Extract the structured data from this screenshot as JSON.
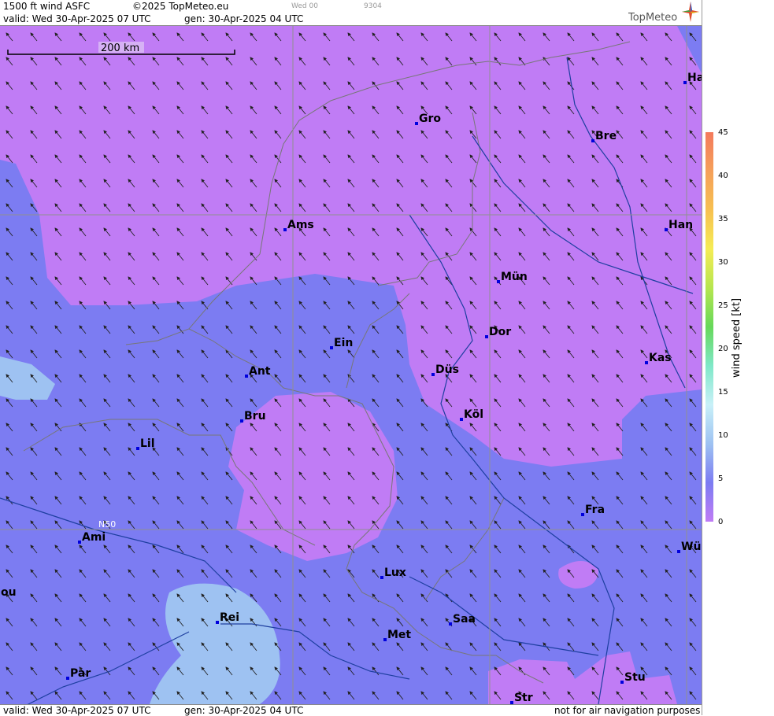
{
  "header": {
    "product": "1500 ft wind ASFC",
    "copyright": "©2025 TopMeteo.eu",
    "day_code": "Wed 00",
    "code": "9304",
    "valid": "valid:  Wed  30-Apr-2025  07 UTC",
    "gen": "gen: 30-Apr-2025 04 UTC",
    "brand": "TopMeteo"
  },
  "footer": {
    "valid": "valid:  Wed  30-Apr-2025  07 UTC",
    "gen": "gen: 30-Apr-2025 04 UTC",
    "disclaimer": "not for air navigation purposes"
  },
  "scale_bar": {
    "label": "200 km"
  },
  "latitude_label": "N50",
  "legend": {
    "title": "wind  speed  [kt]",
    "ticks": [
      "45",
      "40",
      "35",
      "30",
      "25",
      "20",
      "15",
      "10",
      "5",
      "0"
    ],
    "colors": [
      "#f47a5c",
      "#f5a05a",
      "#f7c050",
      "#f5ec55",
      "#b6e64f",
      "#66d85a",
      "#7fe8c8",
      "#c8f0f8",
      "#9ec2f2",
      "#7c7cf2",
      "#c07cf5"
    ]
  },
  "cities": [
    {
      "name": "Gro"
    },
    {
      "name": "Bre"
    },
    {
      "name": "Ha"
    },
    {
      "name": "Ams"
    },
    {
      "name": "Han"
    },
    {
      "name": "Mün"
    },
    {
      "name": "Ein"
    },
    {
      "name": "Dor"
    },
    {
      "name": "Ant"
    },
    {
      "name": "Düs"
    },
    {
      "name": "Kas"
    },
    {
      "name": "Bru"
    },
    {
      "name": "Köl"
    },
    {
      "name": "Lil"
    },
    {
      "name": "Fra"
    },
    {
      "name": "Ami"
    },
    {
      "name": "Wü"
    },
    {
      "name": "Lux"
    },
    {
      "name": "ou"
    },
    {
      "name": "Rei"
    },
    {
      "name": "Saa"
    },
    {
      "name": "Met"
    },
    {
      "name": "Par"
    },
    {
      "name": "Stu"
    },
    {
      "name": "Str"
    }
  ],
  "map_colors": {
    "calm": "#c07cf5",
    "light": "#7c7cf2",
    "moderate": "#9ec2f2",
    "grid": "#909090",
    "border": "#777777",
    "river": "#1e3fa0",
    "marker": "#0000dd"
  }
}
